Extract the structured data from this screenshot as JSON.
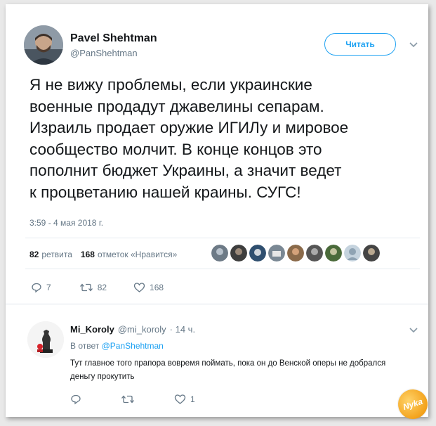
{
  "author": {
    "name": "Pavel Shehtman",
    "handle": "@PanShehtman",
    "follow_label": "Читать"
  },
  "tweet": {
    "text": "Я не вижу проблемы, если украинские\nвоенные продадут джавелины сепарам.\nИзраиль продает оружие ИГИЛу и мировое\nсообщество молчит. В конце концов это\nпополнит бюджет Украины, а значит ведет\nк процветанию нашей краины. СУГС!",
    "timestamp": "3:59 - 4 мая 2018 г."
  },
  "stats": {
    "retweets_count": "82",
    "retweets_label": "ретвита",
    "likes_count": "168",
    "likes_label": "отметок «Нравится»"
  },
  "actions": {
    "reply_count": "7",
    "retweet_count": "82",
    "like_count": "168"
  },
  "reply": {
    "name": "Mi_Koroly",
    "handle": "@mi_koroly",
    "time": "· 14 ч.",
    "reply_to_prefix": "В ответ",
    "reply_to_handle": "@PanShehtman",
    "text": "Тут главное того прапора вовремя поймать, пока он до Венской оперы не добрался деньгу прокутить",
    "like_count": "1"
  },
  "watermark": {
    "text": "Nyka"
  },
  "colors": {
    "accent": "#1da1f2",
    "muted": "#657786",
    "text": "#14171a"
  }
}
